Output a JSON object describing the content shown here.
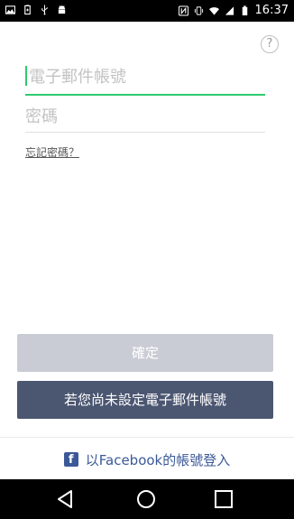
{
  "status_bar": {
    "time": "16:37",
    "left_icons": [
      "image-icon",
      "battery-saver-icon",
      "usb-icon",
      "android-icon"
    ],
    "right_icons": [
      "nfc-icon",
      "vibrate-icon",
      "wifi-icon",
      "signal-icon",
      "battery-icon"
    ]
  },
  "help": {
    "label": "?"
  },
  "form": {
    "email_placeholder": "電子郵件帳號",
    "email_value": "",
    "password_placeholder": "密碼",
    "password_value": "",
    "forgot_password": "忘記密碼？"
  },
  "buttons": {
    "confirm": "確定",
    "set_email": "若您尚未設定電子郵件帳號"
  },
  "facebook": {
    "icon_letter": "f",
    "label": "以Facebook的帳號登入"
  },
  "colors": {
    "accent_green": "#2fcb6f",
    "button_disabled": "#c9ccd5",
    "button_dark": "#4b5671",
    "facebook_blue": "#3b5998"
  }
}
